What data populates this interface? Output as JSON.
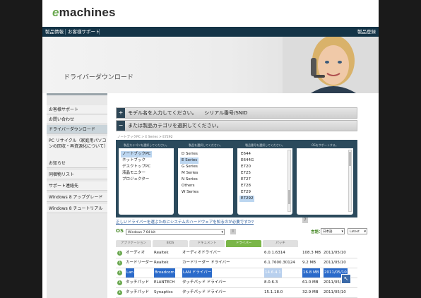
{
  "header": {
    "logo_e": "e",
    "logo_rest": "machines"
  },
  "nav": {
    "product_info": "製品情報",
    "support": "お客様サポート",
    "register": "製品登録"
  },
  "hero": {
    "title": "ドライバーダウンロード"
  },
  "sidebar": {
    "items": [
      "お客様サポート",
      "お問い合わせ",
      "ドライバーダウンロード",
      "PC リサイクル（家庭用パソコンの回収・再資源化について）",
      "お知らせ",
      "同梱物リスト",
      "サポート連絡先",
      "Windows 8 アップグレード",
      "Windows 8 チュートリアル"
    ]
  },
  "accordion": {
    "model_row": "モデル名を入力してください。　　シリアル番号/SNID",
    "category_row": "または製品カテゴリを選択してください。",
    "model_icon": "+",
    "category_icon": "−"
  },
  "breadcrumb": "ノートブックPC > E Series > E7292",
  "selector": {
    "col1": {
      "head": "製品カテゴリを選択してください。",
      "options": [
        "ノートブックPC",
        "ネットブック",
        "デスクトップPC",
        "液晶モニター",
        "プロジェクター"
      ],
      "selected_index": 0
    },
    "col2": {
      "head": "製品を選択してください。",
      "options": [
        "D Series",
        "E Series",
        "G Series",
        "M Series",
        "N Series",
        "Others",
        "W Series"
      ],
      "selected_index": 1
    },
    "col3": {
      "head": "製品番号を選択してください。",
      "options": [
        "E644",
        "E644G",
        "E720",
        "E725",
        "E727",
        "E728",
        "E729",
        "E7292"
      ],
      "selected_index": 7
    },
    "col4": {
      "head": "OSをサポートする。"
    }
  },
  "help_link": "正しいドライバーを選ぶためにシステムのハードウェアを知るのが必要ですか?",
  "help_icon": "?",
  "os": {
    "label": "OS",
    "value": "Windows 7 64-bit",
    "info_icon": "i",
    "lang_label": "言語：",
    "lang_value": "日本語",
    "version_value": "Latest"
  },
  "tabs": [
    "アプリケーション",
    "BIOS",
    "ドキュメント",
    "ドライバー",
    "パッチ"
  ],
  "active_tab": 3,
  "drivers": [
    {
      "category": "オーディオ",
      "vendor": "Realtek",
      "description": "オーディオドライバー",
      "version": "6.0.1.6314",
      "size": "108.3 MB",
      "date": "2011/05/10"
    },
    {
      "category": "カードリーダー",
      "vendor": "Realtek",
      "description": "カードリーダー ドライバー",
      "version": "6.1.7600.30124",
      "size": "9.2 MB",
      "date": "2011/05/10"
    },
    {
      "category": "Lan",
      "vendor": "Broadcom",
      "description": "LAN ドライバー",
      "version": "14.6.4.1",
      "size": "16.8 MB",
      "date": "2011/05/10"
    },
    {
      "category": "タッチパッド",
      "vendor": "ELANTECH",
      "description": "タッチパッド ドライバー",
      "version": "8.0.6.3",
      "size": "61.0 MB",
      "date": "2011/05/10"
    },
    {
      "category": "タッチパッド",
      "vendor": "Synaptics",
      "description": "タッチパッド ドライバー",
      "version": "15.1.18.0",
      "size": "32.9 MB",
      "date": "2011/05/10"
    }
  ],
  "highlight_row": 2,
  "colors": {
    "nav": "#143447",
    "accent_green": "#7ab648",
    "panel": "#2b4a5c"
  }
}
